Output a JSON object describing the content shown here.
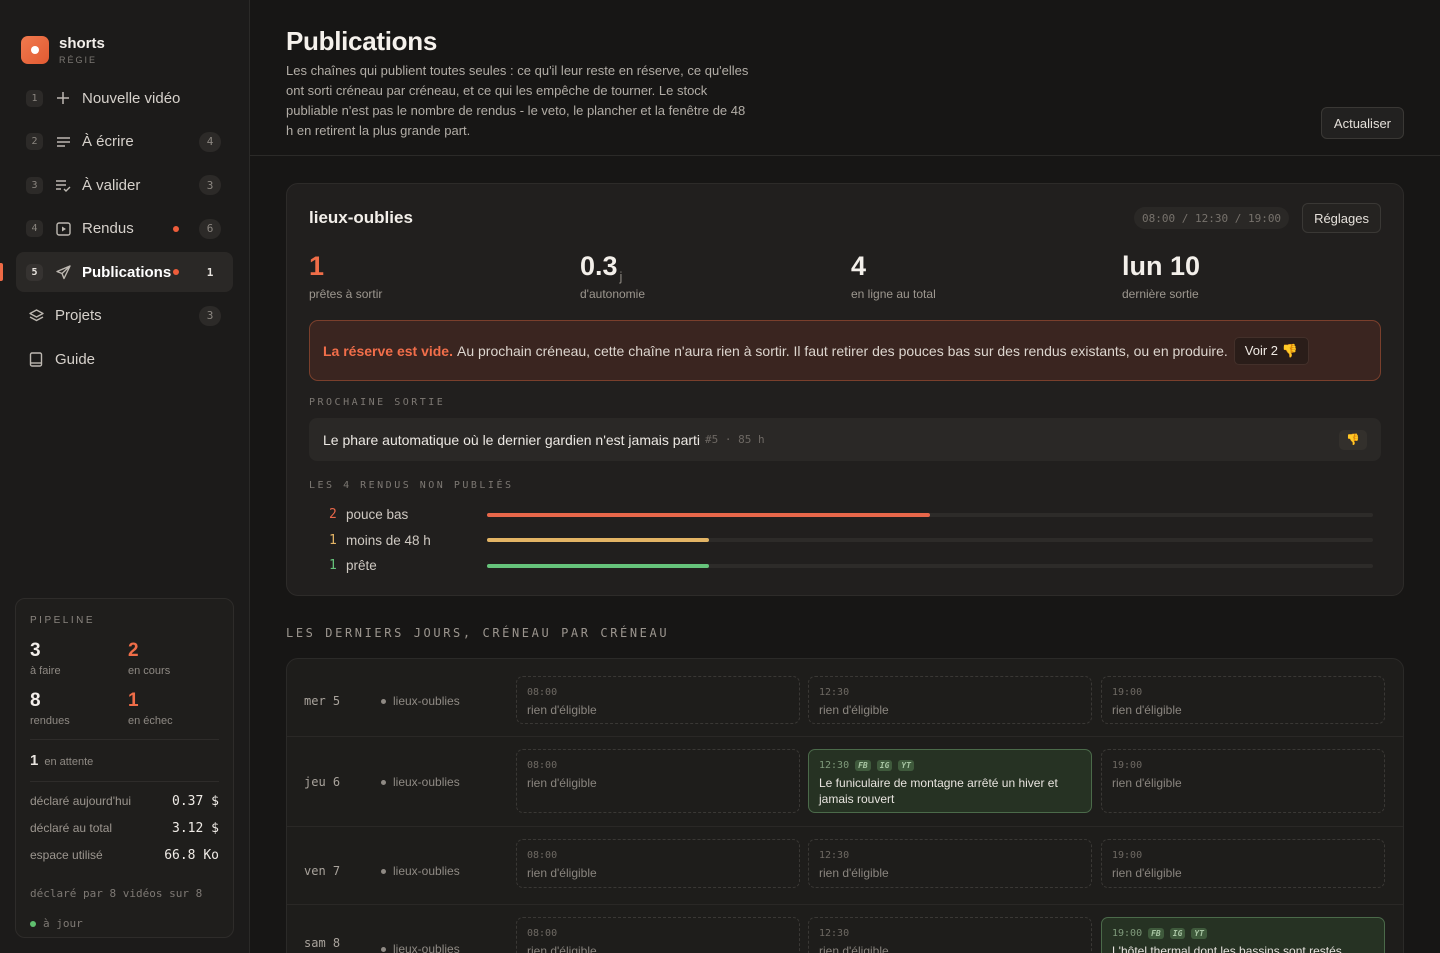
{
  "brand": {
    "name": "shorts",
    "sub": "RÉGIE"
  },
  "nav": [
    {
      "idx": "1",
      "label": "Nouvelle vidéo",
      "icon": "plus-icon",
      "count": "",
      "dot": false,
      "active": false
    },
    {
      "idx": "2",
      "label": "À écrire",
      "icon": "lines-icon",
      "count": "4",
      "dot": false,
      "active": false
    },
    {
      "idx": "3",
      "label": "À valider",
      "icon": "list-check-icon",
      "count": "3",
      "dot": false,
      "active": false
    },
    {
      "idx": "4",
      "label": "Rendus",
      "icon": "play-box-icon",
      "count": "6",
      "dot": true,
      "active": false
    },
    {
      "idx": "5",
      "label": "Publications",
      "icon": "send-icon",
      "count": "1",
      "dot": true,
      "active": true
    },
    {
      "idx": "",
      "label": "Projets",
      "icon": "layers-icon",
      "count": "3",
      "dot": false,
      "active": false
    },
    {
      "idx": "",
      "label": "Guide",
      "icon": "book-icon",
      "count": "",
      "dot": false,
      "active": false
    }
  ],
  "pipeline": {
    "title": "PIPELINE",
    "todo": {
      "n": "3",
      "label": "à faire"
    },
    "inprogress": {
      "n": "2",
      "label": "en cours"
    },
    "rendered": {
      "n": "8",
      "label": "rendues"
    },
    "failed": {
      "n": "1",
      "label": "en échec"
    },
    "waiting": {
      "n": "1",
      "label": "en attente"
    },
    "rows": [
      {
        "label": "déclaré aujourd'hui",
        "value": "0.37 $"
      },
      {
        "label": "déclaré au total",
        "value": "3.12 $"
      },
      {
        "label": "espace utilisé",
        "value": "66.8 Ko"
      }
    ],
    "foot": "déclaré par 8 vidéos sur 8",
    "status": "à jour"
  },
  "header": {
    "title": "Publications",
    "desc": "Les chaînes qui publient toutes seules : ce qu'il leur reste en réserve, ce qu'elles ont sorti créneau par créneau, et ce qui les empêche de tourner. Le stock publiable n'est pas le nombre de rendus - le veto, le plancher et la fenêtre de 48 h en retirent la plus grande part.",
    "refresh": "Actualiser"
  },
  "channel": {
    "name": "lieux-oublies",
    "slots": "08:00 / 12:30 / 19:00",
    "settings": "Réglages",
    "stats": [
      {
        "value": "1",
        "unit": "",
        "label": "prêtes à sortir",
        "orange": true
      },
      {
        "value": "0.3",
        "unit": "j",
        "label": "d'autonomie",
        "orange": false
      },
      {
        "value": "4",
        "unit": "",
        "label": "en ligne au total",
        "orange": false
      },
      {
        "value": "lun 10",
        "unit": "",
        "label": "dernière sortie",
        "orange": false
      }
    ],
    "alert": {
      "strong": "La réserve est vide.",
      "text": "Au prochain créneau, cette chaîne n'aura rien à sortir. Il faut retirer des pouces bas sur des rendus existants, ou en produire.",
      "button": "Voir 2 👎"
    },
    "next_label": "PROCHAINE SORTIE",
    "next": {
      "title": "Le phare automatique où le dernier gardien n'est jamais parti",
      "meta": "#5 · 85 h",
      "thumb": "👎"
    },
    "unpublished_label": "LES 4 RENDUS NON PUBLIÉS",
    "bars": [
      {
        "n": "2",
        "label": "pouce bas",
        "fraction": 0.5,
        "color": "#e8674a"
      },
      {
        "n": "1",
        "label": "moins de 48 h",
        "fraction": 0.25,
        "color": "#e3b465"
      },
      {
        "n": "1",
        "label": "prête",
        "fraction": 0.25,
        "color": "#66c37b"
      }
    ]
  },
  "days_title": "LES DERNIERS JOURS, CRÉNEAU PAR CRÉNEAU",
  "days": [
    {
      "day": "mer 5",
      "channel": "lieux-oublies",
      "slots": [
        {
          "time": "08:00",
          "text": "rien d'éligible",
          "pub": false,
          "tags": []
        },
        {
          "time": "12:30",
          "text": "rien d'éligible",
          "pub": false,
          "tags": []
        },
        {
          "time": "19:00",
          "text": "rien d'éligible",
          "pub": false,
          "tags": []
        }
      ]
    },
    {
      "day": "jeu 6",
      "channel": "lieux-oublies",
      "slots": [
        {
          "time": "08:00",
          "text": "rien d'éligible",
          "pub": false,
          "tags": []
        },
        {
          "time": "12:30",
          "text": "Le funiculaire de montagne arrêté un hiver et jamais rouvert",
          "pub": true,
          "tags": [
            "FB",
            "IG",
            "YT"
          ]
        },
        {
          "time": "19:00",
          "text": "rien d'éligible",
          "pub": false,
          "tags": []
        }
      ]
    },
    {
      "day": "ven 7",
      "channel": "lieux-oublies",
      "slots": [
        {
          "time": "08:00",
          "text": "rien d'éligible",
          "pub": false,
          "tags": []
        },
        {
          "time": "12:30",
          "text": "rien d'éligible",
          "pub": false,
          "tags": []
        },
        {
          "time": "19:00",
          "text": "rien d'éligible",
          "pub": false,
          "tags": []
        }
      ]
    },
    {
      "day": "sam 8",
      "channel": "lieux-oublies",
      "slots": [
        {
          "time": "08:00",
          "text": "rien d'éligible",
          "pub": false,
          "tags": []
        },
        {
          "time": "12:30",
          "text": "rien d'éligible",
          "pub": false,
          "tags": []
        },
        {
          "time": "19:00",
          "text": "L'hôtel thermal dont les bassins sont restés",
          "pub": true,
          "tags": [
            "FB",
            "IG",
            "YT"
          ]
        }
      ]
    }
  ]
}
